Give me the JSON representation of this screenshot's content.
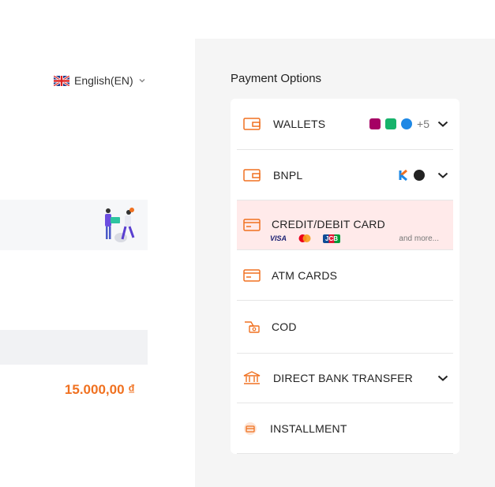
{
  "language": {
    "label": "English(EN)"
  },
  "order": {
    "amount": "15.000,00 ₫"
  },
  "payment": {
    "title": "Payment Options",
    "options": [
      {
        "label": "WALLETS",
        "more": "+5"
      },
      {
        "label": "BNPL"
      },
      {
        "label": "CREDIT/DEBIT CARD",
        "sub_more": "and more..."
      },
      {
        "label": "ATM CARDS"
      },
      {
        "label": "COD"
      },
      {
        "label": "DIRECT BANK TRANSFER"
      },
      {
        "label": "INSTALLMENT"
      }
    ]
  },
  "card_brands": {
    "visa": "VISA",
    "jcb": "JCB"
  },
  "colors": {
    "accent": "#f07120",
    "selected_bg": "#ffeaea",
    "panel_bg": "#f5f5f5"
  }
}
